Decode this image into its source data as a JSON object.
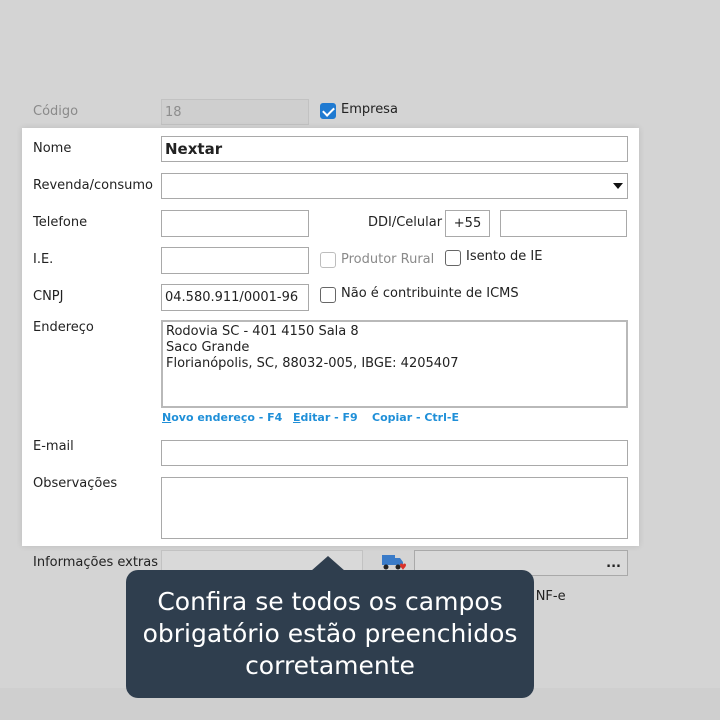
{
  "form": {
    "codigo_label": "Código",
    "codigo_value": "18",
    "empresa_label": "Empresa",
    "empresa_checked": true,
    "nome_label": "Nome",
    "nome_value": "Nextar",
    "revenda_label": "Revenda/consumo",
    "revenda_value": "",
    "telefone_label": "Telefone",
    "telefone_value": "",
    "ddi_label": "DDI/Celular",
    "ddi_value": "+55",
    "celular_value": "",
    "ie_label": "I.E.",
    "ie_value": "",
    "produtor_rural_label": "Produtor Rural",
    "isento_ie_label": "Isento de IE",
    "cnpj_label": "CNPJ",
    "cnpj_value": "04.580.911/0001-96",
    "nao_contribuinte_label": "Não é contribuinte de ICMS",
    "endereco_label": "Endereço",
    "endereco_lines": [
      "Rodovia SC - 401 4150 Sala 8",
      "Saco Grande",
      "Florianópolis, SC, 88032-005, IBGE: 4205407"
    ],
    "links": {
      "novo_hotkey_letter": "N",
      "novo_rest": "ovo endereço - F4",
      "editar_hotkey_letter": "E",
      "editar_rest": "ditar - F9",
      "copiar": "Copiar - Ctrl-E"
    },
    "email_label": "E-mail",
    "email_value": "",
    "observacoes_label": "Observações",
    "observacoes_value": "",
    "info_extras_label": "Informações extras",
    "info_extras_value": "",
    "ellipsis_label": "...",
    "nfe_partial_label": "la NF-e"
  },
  "tooltip": {
    "lines": [
      "Confira se todos os campos",
      "obrigatório estão preenchidos",
      "corretamente"
    ]
  },
  "icons": {
    "dropdown": "triangle-down",
    "truck": "delivery-truck-heart-icon"
  },
  "colors": {
    "accent": "#1f7ad1",
    "link": "#1f8fd8",
    "tooltip_bg": "#2f3e4e"
  }
}
